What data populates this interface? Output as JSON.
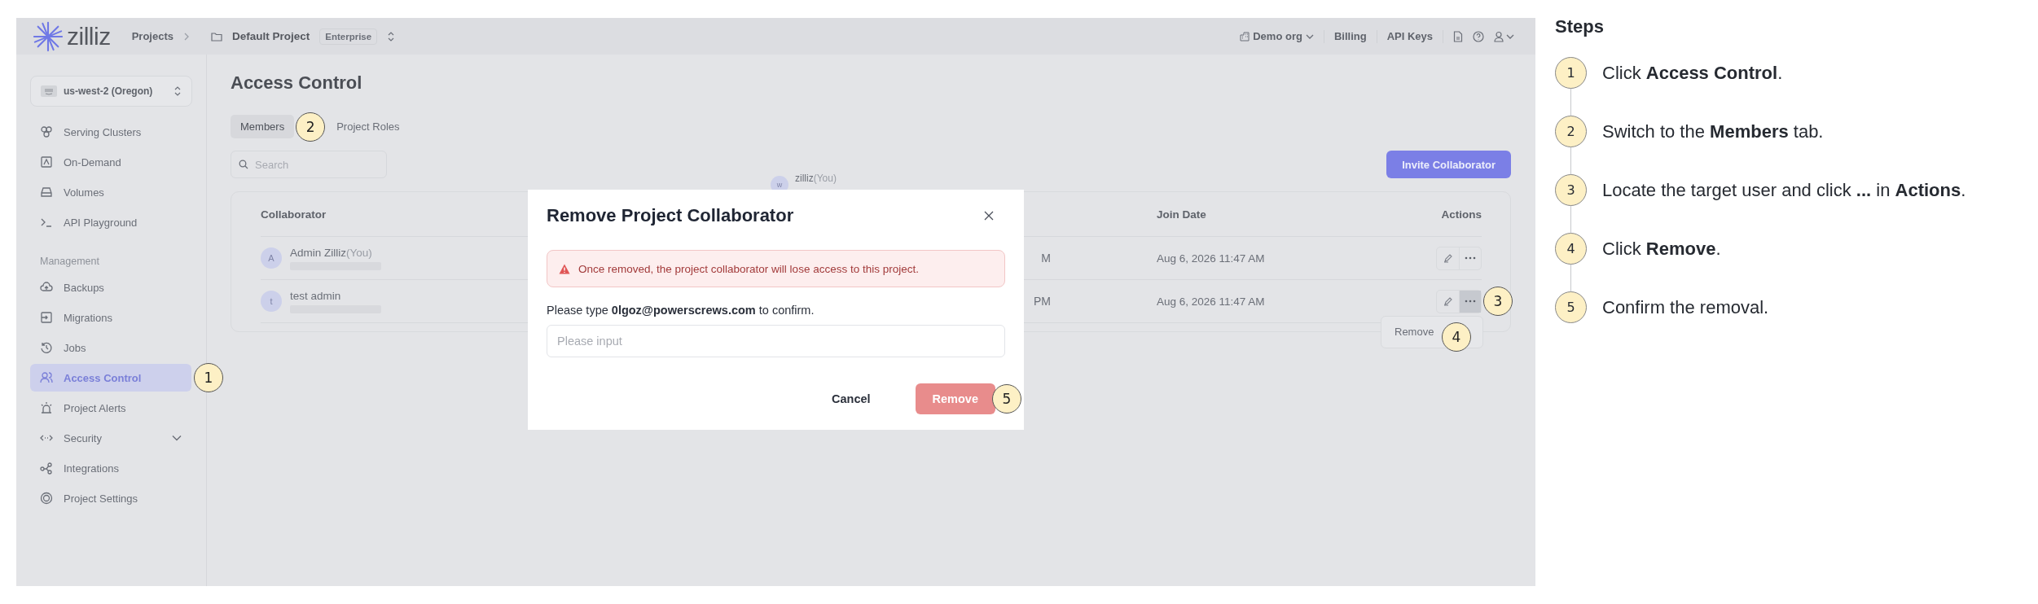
{
  "topbar": {
    "logo": "zilliz",
    "projects_link": "Projects",
    "project": "Default Project",
    "plan_badge": "Enterprise",
    "org": "Demo org",
    "links": [
      "Billing",
      "API Keys"
    ]
  },
  "sidebar": {
    "region": "us-west-2 (Oregon)",
    "items": [
      {
        "label": "Serving Clusters",
        "selected": false
      },
      {
        "label": "On-Demand",
        "selected": false
      },
      {
        "label": "Volumes",
        "selected": false
      },
      {
        "label": "API Playground",
        "selected": false
      }
    ],
    "section_title": "Management",
    "management_items": [
      {
        "label": "Backups",
        "selected": false
      },
      {
        "label": "Migrations",
        "selected": false
      },
      {
        "label": "Jobs",
        "selected": false
      },
      {
        "label": "Access Control",
        "selected": true,
        "callout": "1"
      },
      {
        "label": "Project Alerts",
        "selected": false
      },
      {
        "label": "Security",
        "selected": false,
        "expanded": false
      },
      {
        "label": "Integrations",
        "selected": false
      },
      {
        "label": "Project Settings",
        "selected": false
      }
    ]
  },
  "main": {
    "title": "Access Control",
    "tabs": [
      {
        "label": "Members",
        "selected": true,
        "callout": "2"
      },
      {
        "label": "Project Roles",
        "selected": false
      }
    ],
    "search": {
      "placeholder": "Search"
    },
    "invite_button": "Invite Collaborator",
    "table": {
      "columns": [
        "Collaborator",
        "Join Date",
        "Actions"
      ],
      "rows": [
        {
          "avatar": "A",
          "name": "Admin Zilliz",
          "tag": "(You)",
          "column_2": "M",
          "join_date": "Aug 6, 2026 11:47 AM",
          "menu_open": false
        },
        {
          "avatar": "t",
          "name": "test admin",
          "column_2": "PM",
          "join_date": "Aug 6, 2026 11:47 AM",
          "menu_open": true,
          "callout": "3",
          "menu": [
            {
              "label": "Remove",
              "callout": "4"
            }
          ]
        }
      ]
    },
    "floating_row": {
      "avatar": "w",
      "name": "zilliz",
      "tag": "(You)"
    }
  },
  "dialog": {
    "title": "Remove Project Collaborator",
    "warning": "Once removed, the project collaborator will lose access to this project.",
    "prompt": "Please type **0lgoz@powerscrews.com** to confirm.",
    "input": {
      "placeholder": "Please input"
    },
    "buttons": [
      {
        "label": "Cancel",
        "kind": "secondary",
        "disabled": false
      },
      {
        "label": "Remove",
        "kind": "danger",
        "disabled": true,
        "callout": "5"
      }
    ]
  },
  "steps": {
    "title": "Steps",
    "items": [
      {
        "number": "1",
        "text": "Click **Access Control**."
      },
      {
        "number": "2",
        "text": "Switch to the **Members** tab."
      },
      {
        "number": "3",
        "text": "Locate the target user and click **...** in **Actions**."
      },
      {
        "number": "4",
        "text": "Click **Remove**."
      },
      {
        "number": "5",
        "text": "Confirm the removal."
      }
    ]
  }
}
